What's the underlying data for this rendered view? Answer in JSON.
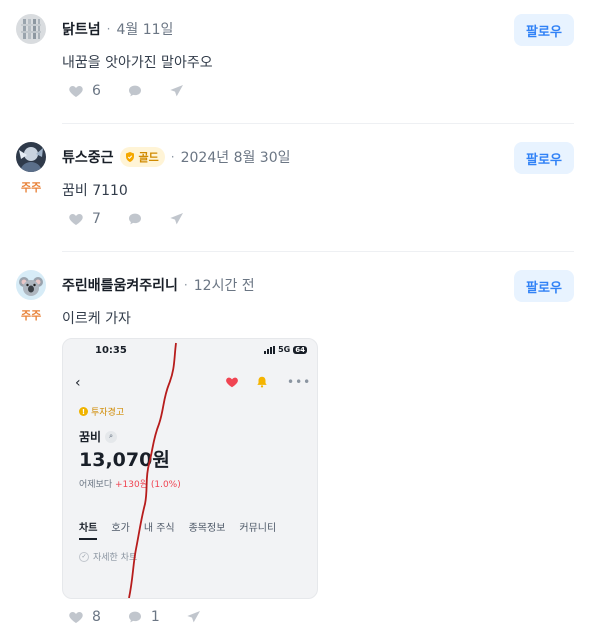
{
  "posts": [
    {
      "username": "닭트넘",
      "time": "4월 11일",
      "follow_label": "팔로우",
      "content": "내꿈을 앗아가진 말아주오",
      "likes": "6"
    },
    {
      "username": "튜스중근",
      "badge_label": "골드",
      "time": "2024년 8월 30일",
      "follow_label": "팔로우",
      "holder_label": "주주",
      "content": "꿈비 7110",
      "likes": "7"
    },
    {
      "username": "주린배를움켜주리니",
      "time": "12시간 전",
      "follow_label": "팔로우",
      "holder_label": "주주",
      "content": "이르케 가자",
      "likes": "8",
      "comments": "1"
    }
  ],
  "screenshot": {
    "status_time": "10:35",
    "network": "5G",
    "battery": "64",
    "warning": "투자경고",
    "stock_name": "꿈비",
    "price": "13,070원",
    "change_prefix": "어제보다",
    "change_value": "+130원 (1.0%)",
    "tabs": [
      "차트",
      "호가",
      "내 주식",
      "종목정보",
      "커뮤니티"
    ],
    "detail_chart": "자세한 차트"
  },
  "colors": {
    "accent": "#3182f6",
    "follow_bg": "#e8f3ff",
    "holder_orange": "#e8833a",
    "up_red": "#f04452"
  },
  "icons": [
    "heart-icon",
    "comment-icon",
    "share-icon",
    "gold-shield-icon",
    "back-icon",
    "bell-icon",
    "more-icon"
  ]
}
